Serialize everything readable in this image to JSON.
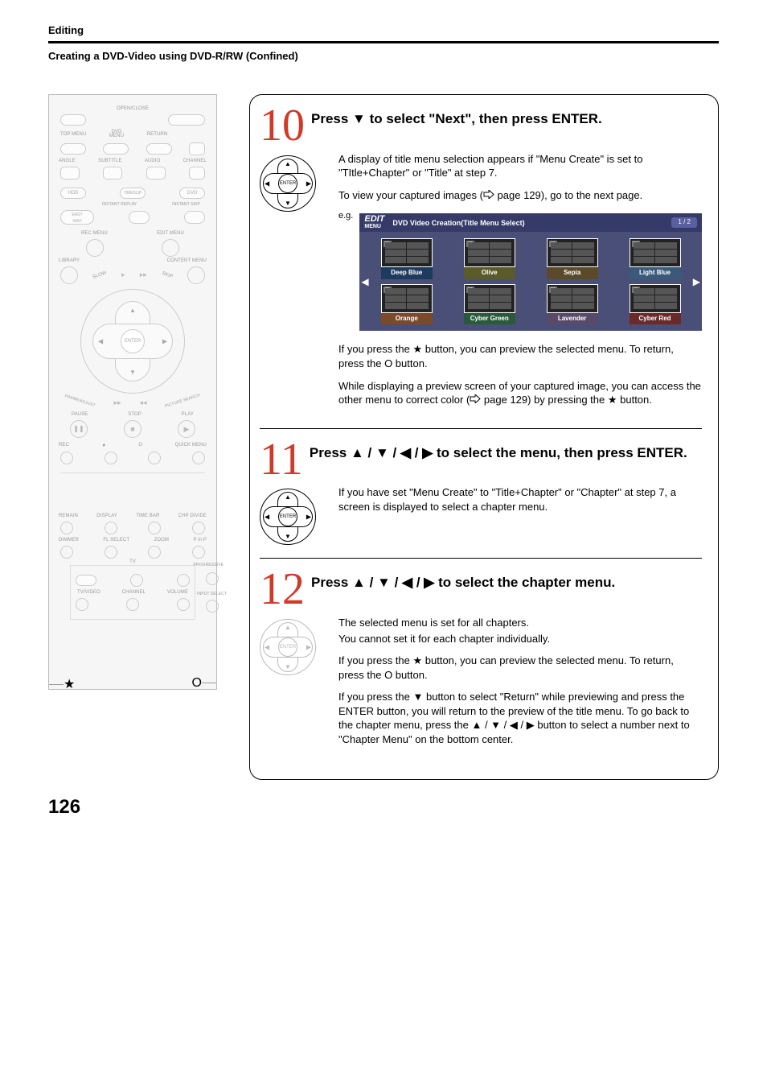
{
  "header": {
    "section": "Editing",
    "subtitle": "Creating a DVD-Video using DVD-R/RW (Confined)"
  },
  "remote": {
    "open_close": "OPEN/CLOSE",
    "top_menu": "TOP MENU",
    "dvd_menu_top": "DVD",
    "dvd_menu_bottom": "MENU",
    "return": "RETURN",
    "angle": "ANGLE",
    "subtitle": "SUBTITLE",
    "audio": "AUDIO",
    "channel": "CHANNEL",
    "hdd": "HDD",
    "timeslip": "TIMESLIP",
    "dvd": "DVD",
    "instant_replay": "INSTANT REPLAY",
    "instant_skip": "INSTANT SKIP",
    "easy_navi": "EASY\nNAVI",
    "rec_menu": "REC MENU",
    "edit_menu": "EDIT MENU",
    "library": "LIBRARY",
    "content_menu": "CONTENT MENU",
    "slow": "SLOW",
    "skip": "SKIP",
    "enter": "ENTER",
    "frame_adjust": "FRAME/ADJUST",
    "picture_search": "PICTURE SEARCH",
    "pause": "PAUSE",
    "stop": "STOP",
    "play": "PLAY",
    "rec": "REC",
    "star": "★",
    "o": "O",
    "quick_menu": "QUICK MENU",
    "remain": "REMAIN",
    "display": "DISPLAY",
    "timebar": "TIME BAR",
    "chp_divide": "CHP DIVIDE",
    "dimmer": "DIMMER",
    "fl_select": "FL SELECT",
    "zoom": "ZOOM",
    "pinp": "P in P",
    "tv": "TV",
    "progressive": "PROGRESSIVE",
    "tv_video": "TV/VIDEO",
    "channel2": "CHANNEL",
    "volume": "VOLUME",
    "input_select": "INPUT SELECT",
    "callout_star": "★",
    "callout_o": "O"
  },
  "steps": {
    "s10": {
      "num": "10",
      "title_a": "Press ",
      "title_b": " to select \"Next\", then press ENTER.",
      "p1a": "A display of title menu selection appears if \"Menu Create\" is set to \"TItle+Chapter\" or \"Title\" at step 7.",
      "p2a": "To view your captured images (",
      "p2b": " page 129), go to the next page.",
      "eg": "e.g.",
      "panel_title_a": "EDIT",
      "panel_title_b": "MENU",
      "panel_caption": "DVD Video Creation(Title Menu Select)",
      "pager": "1 / 2",
      "thumbs": [
        "Deep Blue",
        "Olive",
        "Sepia",
        "Light Blue",
        "Orange",
        "Cyber Green",
        "Lavender",
        "Cyber Red"
      ],
      "thumbtags": [
        "01",
        "02",
        "03",
        "04",
        "05",
        "06",
        "07",
        "08"
      ],
      "p3a": "If you press the ",
      "p3b": " button, you can preview the selected menu. To return, press the O button.",
      "p4a": "While displaying a preview screen of your captured image, you can access the other menu to correct color (",
      "p4b": " page 129) by pressing the ",
      "p4c": " button.",
      "enter": "ENTER"
    },
    "s11": {
      "num": "11",
      "title_a": "Press ",
      "title_b": " to select the menu, then press ENTER.",
      "p1": "If you have set \"Menu Create\" to \"Title+Chapter\" or \"Chapter\" at step 7, a screen is displayed to select a chapter menu.",
      "enter": "ENTER"
    },
    "s12": {
      "num": "12",
      "title_a": "Press ",
      "title_b": " to select the chapter menu.",
      "p1": "The selected menu is set for all chapters.",
      "p2": "You cannot set it for each chapter individually.",
      "p3a": "If you press the ",
      "p3b": " button, you can preview the selected menu. To return, press the O button.",
      "p4a": "If you press the ",
      "p4b": " button to select \"Return\" while previewing and press the ENTER button, you will return to the preview of the title menu. To go back to the chapter menu, press the ",
      "p4c": " button to select a number next to \"Chapter Menu\" on the bottom center.",
      "enter": "ENTER"
    }
  },
  "page_number": "126"
}
